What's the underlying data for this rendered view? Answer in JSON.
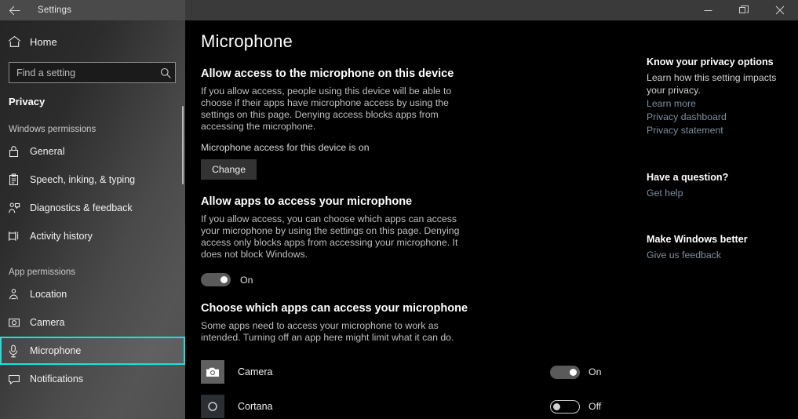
{
  "titlebar": {
    "back_icon": "back-arrow-icon",
    "title": "Settings",
    "minimize_label": "Minimize",
    "restore_label": "Restore",
    "close_label": "Close"
  },
  "sidebar": {
    "home": {
      "icon": "home-icon",
      "label": "Home"
    },
    "search": {
      "placeholder": "Find a setting",
      "value": "",
      "icon": "search-icon"
    },
    "section_title": "Privacy",
    "groups": [
      {
        "label": "Windows permissions",
        "items": [
          {
            "icon": "lock-icon",
            "label": "General",
            "selected": false
          },
          {
            "icon": "clipboard-icon",
            "label": "Speech, inking, & typing",
            "selected": false
          },
          {
            "icon": "diagnostics-icon",
            "label": "Diagnostics & feedback",
            "selected": false
          },
          {
            "icon": "activity-history-icon",
            "label": "Activity history",
            "selected": false
          }
        ]
      },
      {
        "label": "App permissions",
        "items": [
          {
            "icon": "location-icon",
            "label": "Location",
            "selected": false
          },
          {
            "icon": "camera-icon",
            "label": "Camera",
            "selected": false
          },
          {
            "icon": "microphone-icon",
            "label": "Microphone",
            "selected": true
          },
          {
            "icon": "notification-icon",
            "label": "Notifications",
            "selected": false
          }
        ]
      }
    ],
    "highlight_color": "#1ae0e0"
  },
  "main": {
    "page_title": "Microphone",
    "section_device": {
      "heading": "Allow access to the microphone on this device",
      "body": "If you allow access, people using this device will be able to choose if their apps have microphone access by using the settings on this page. Denying access blocks apps from accessing the microphone.",
      "status": "Microphone access for this device is on",
      "button_label": "Change"
    },
    "section_apps": {
      "heading": "Allow apps to access your microphone",
      "body": "If you allow access, you can choose which apps can access your microphone by using the settings on this page. Denying access only blocks apps from accessing your microphone. It does not block Windows.",
      "toggle_state": "on",
      "toggle_label": "On"
    },
    "section_choose": {
      "heading": "Choose which apps can access your microphone",
      "body": "Some apps need to access your microphone to work as intended. Turning off an app here might limit what it can do.",
      "apps": [
        {
          "icon": "camera-app-icon",
          "name": "Camera",
          "toggle_state": "on",
          "toggle_label": "On"
        },
        {
          "icon": "cortana-app-icon",
          "name": "Cortana",
          "toggle_state": "off",
          "toggle_label": "Off"
        }
      ]
    }
  },
  "rail": {
    "privacy": {
      "heading": "Know your privacy options",
      "text": "Learn how this setting impacts your privacy.",
      "links": [
        "Learn more",
        "Privacy dashboard",
        "Privacy statement"
      ]
    },
    "question": {
      "heading": "Have a question?",
      "links": [
        "Get help"
      ]
    },
    "better": {
      "heading": "Make Windows better",
      "links": [
        "Give us feedback"
      ]
    }
  }
}
